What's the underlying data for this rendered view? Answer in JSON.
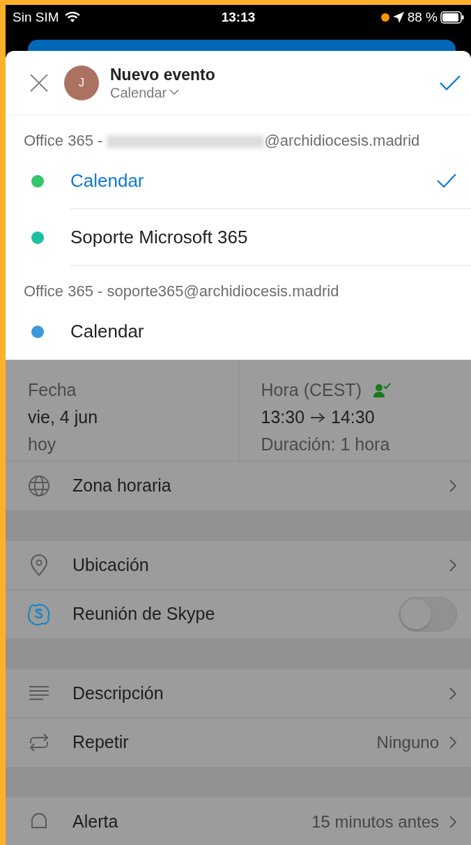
{
  "status_bar": {
    "carrier": "Sin SIM",
    "time": "13:13",
    "battery": "88 %"
  },
  "header": {
    "title": "Nuevo evento",
    "avatar": "J",
    "calendar": "Calendar"
  },
  "calendar_groups": [
    {
      "account_parts": [
        {
          "kind": "text",
          "text": "Office 365 - "
        },
        {
          "kind": "redacted"
        },
        {
          "kind": "text",
          "text": "@archidiocesis.madrid"
        }
      ],
      "calendars": [
        {
          "name": "Calendar",
          "color": "#34c46a",
          "selected": true
        },
        {
          "name": "Soporte Microsoft 365",
          "color": "#1dbf9f",
          "selected": false
        }
      ]
    },
    {
      "account_parts": [
        {
          "kind": "text",
          "text": "Office 365 - soporte365@archidiocesis.madrid"
        }
      ],
      "calendars": [
        {
          "name": "Calendar",
          "color": "#3a98dc",
          "selected": false
        }
      ]
    }
  ],
  "date": {
    "label": "Fecha",
    "value": "vie, 4 jun",
    "note": "hoy"
  },
  "time": {
    "label": "Hora (CEST)",
    "start": "13:30",
    "end": "14:30",
    "duration": "Duración: 1 hora"
  },
  "sections": [
    {
      "rows": [
        {
          "kind": "nav",
          "label": "Zona horaria"
        }
      ]
    },
    {
      "rows": [
        {
          "kind": "nav",
          "label": "Ubicación"
        },
        {
          "kind": "toggle",
          "label": "Reunión de Skype",
          "on": false
        }
      ]
    },
    {
      "rows": [
        {
          "kind": "nav",
          "label": "Descripción"
        },
        {
          "kind": "nav",
          "label": "Repetir",
          "value": "Ninguno"
        }
      ]
    },
    {
      "rows": [
        {
          "kind": "nav",
          "label": "Alerta",
          "value": "15 minutos antes"
        }
      ]
    }
  ]
}
